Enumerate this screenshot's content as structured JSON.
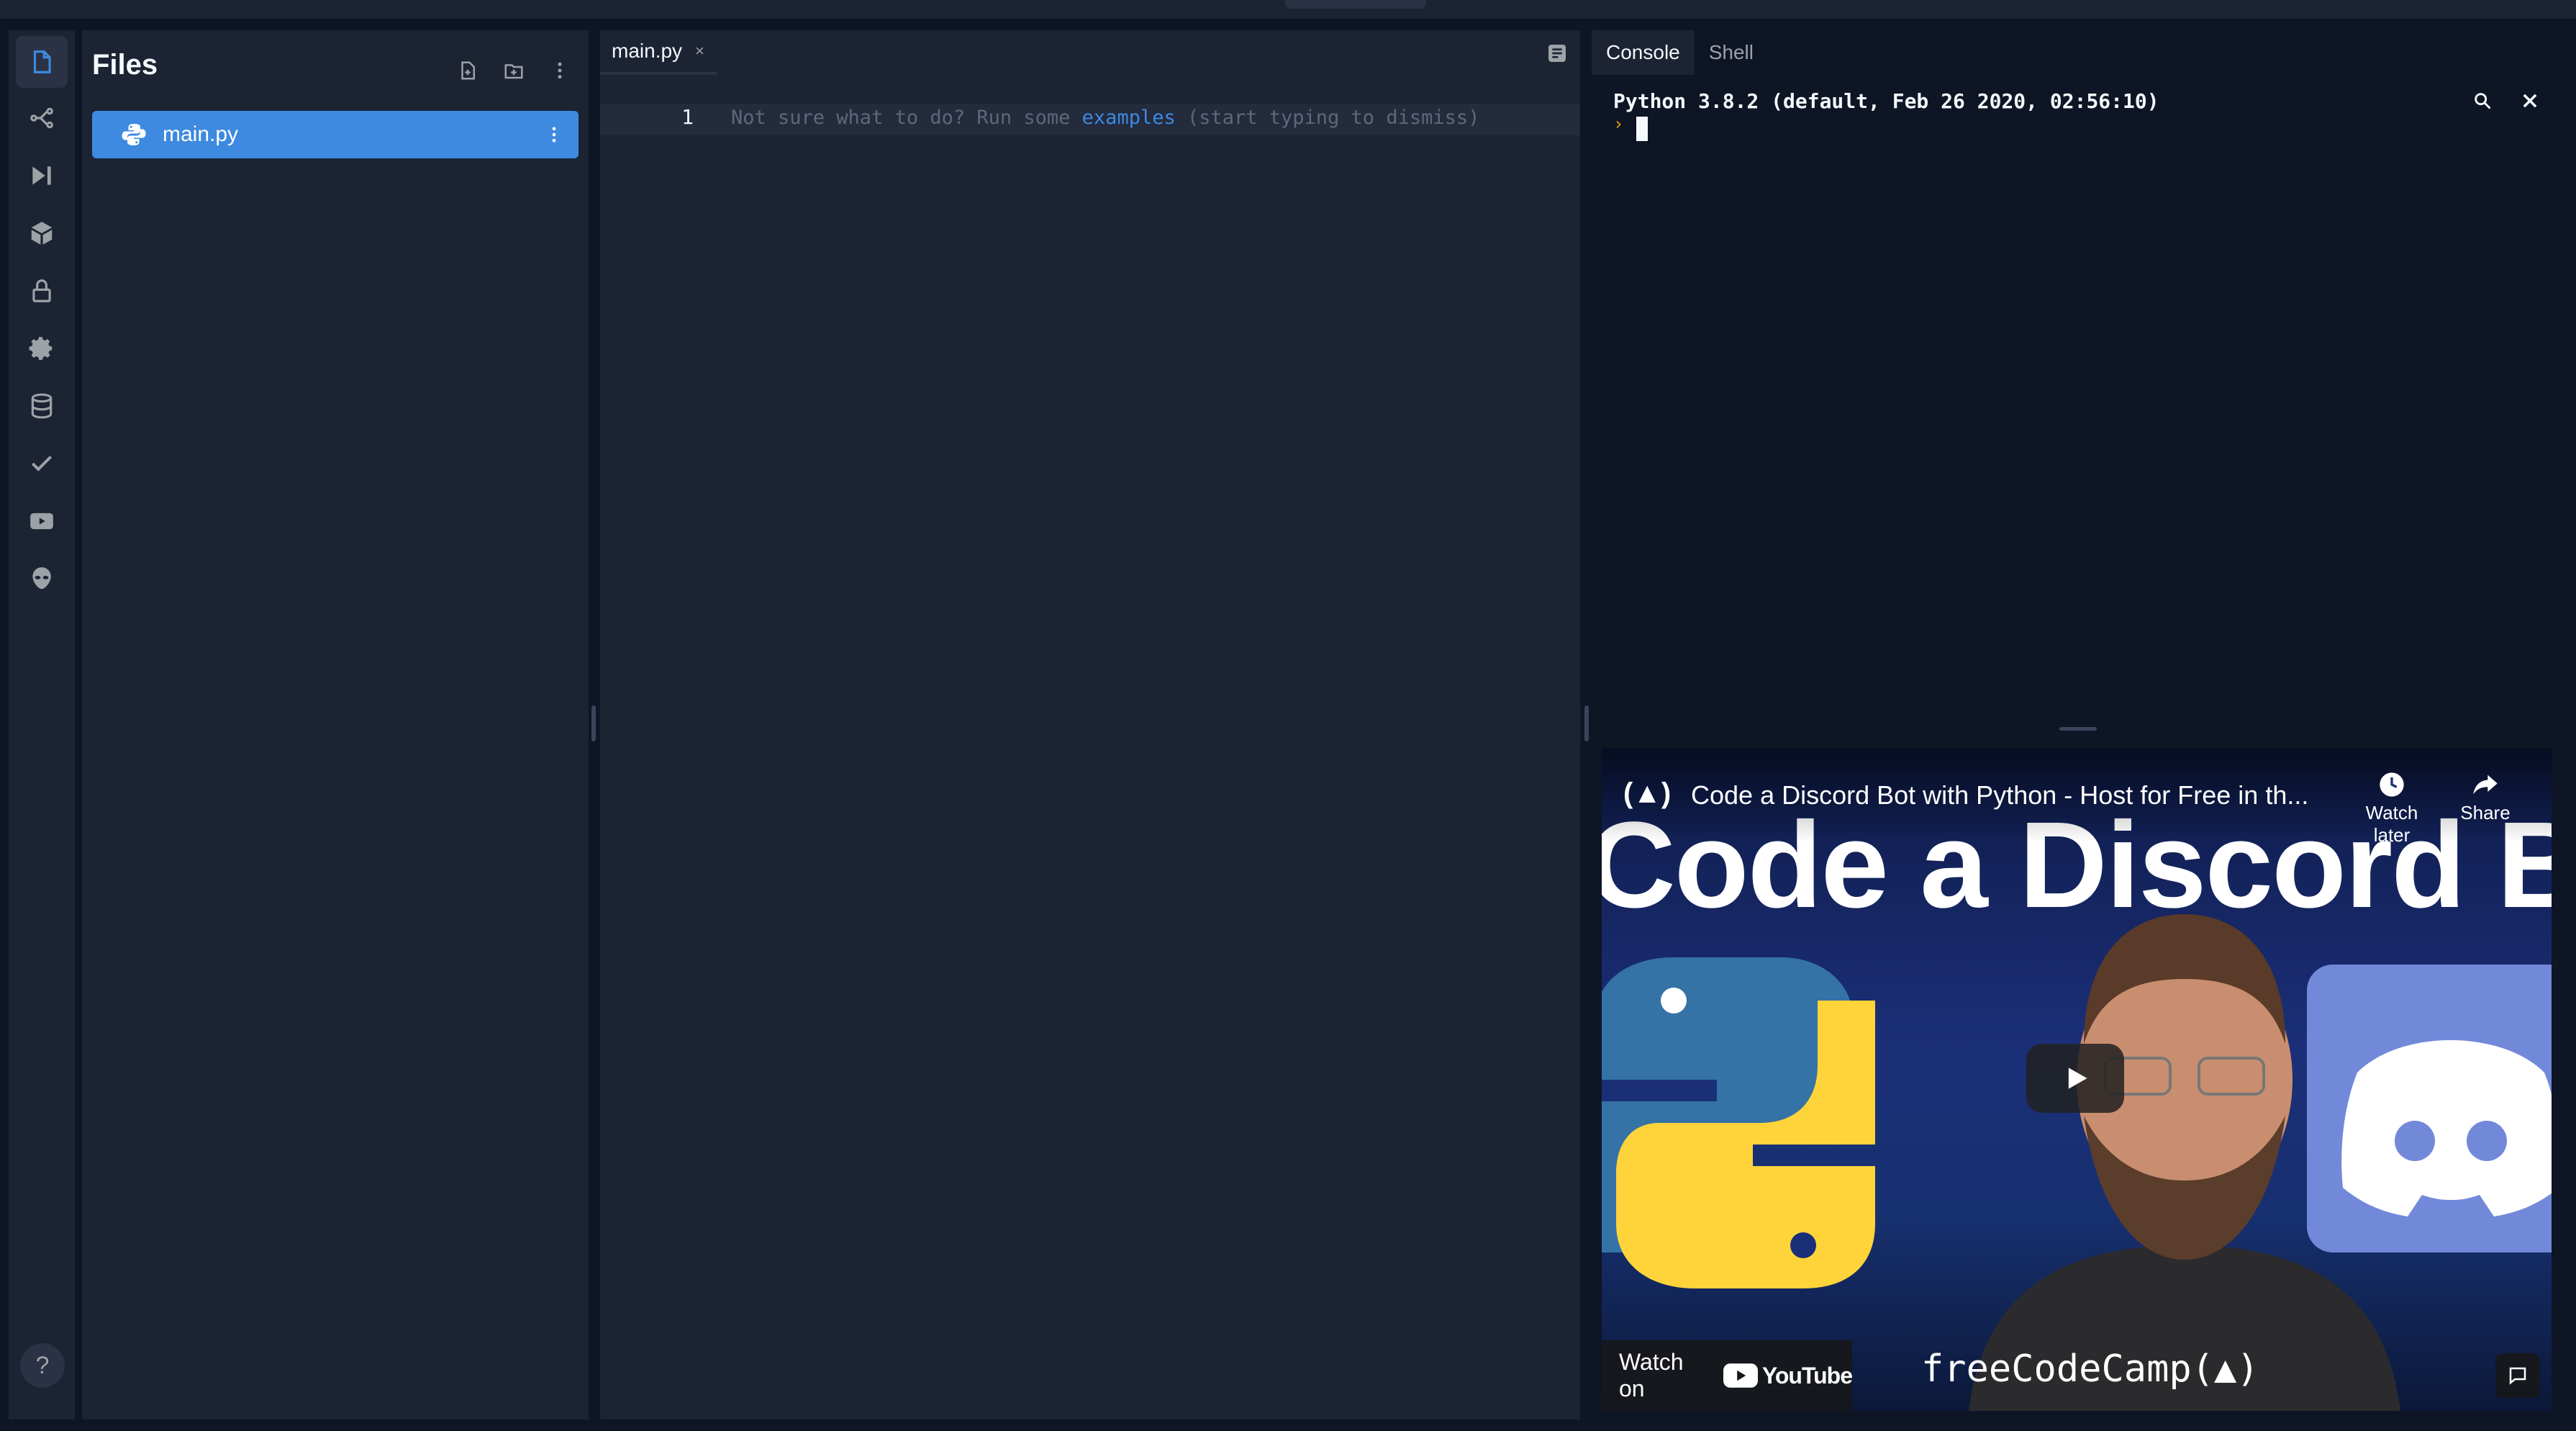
{
  "rail": {
    "items": [
      {
        "icon": "files-icon",
        "active": true
      },
      {
        "icon": "version-control-icon"
      },
      {
        "icon": "debugger-icon"
      },
      {
        "icon": "packages-icon"
      },
      {
        "icon": "secrets-lock-icon"
      },
      {
        "icon": "settings-gear-icon"
      },
      {
        "icon": "database-icon"
      },
      {
        "icon": "unit-tests-check-icon"
      },
      {
        "icon": "video-icon"
      },
      {
        "icon": "alien-icon"
      }
    ],
    "help_label": "?"
  },
  "files": {
    "title": "Files",
    "actions": [
      "new-file-icon",
      "new-folder-icon",
      "more-vertical-icon"
    ],
    "items": [
      {
        "name": "main.py",
        "icon": "python-icon",
        "selected": true
      }
    ]
  },
  "editor": {
    "tab": {
      "label": "main.py",
      "close": "×"
    },
    "line_number": "1",
    "placeholder_before": "Not sure what to do? Run some ",
    "placeholder_link": "examples",
    "placeholder_after": " (start typing to dismiss)"
  },
  "console": {
    "tabs": [
      {
        "label": "Console",
        "active": true
      },
      {
        "label": "Shell",
        "active": false
      }
    ],
    "python_version": "Python 3.8.2 (default, Feb 26 2020, 02:56:10)",
    "prompt": "›"
  },
  "video": {
    "title": "Code a Discord Bot with Python - Host for Free in th...",
    "big_text": "Code a Discord Bo",
    "watch_later": "Watch later",
    "share": "Share",
    "watch_on": "Watch on",
    "youtube_word": "YouTube",
    "fcc_logo": "freeCodeCamp(▲)",
    "channel_logo": "(▲)"
  },
  "colors": {
    "background": "#0e1525",
    "panel": "#1c2333",
    "accent": "#3d8ae0",
    "prompt": "#f0a500"
  }
}
